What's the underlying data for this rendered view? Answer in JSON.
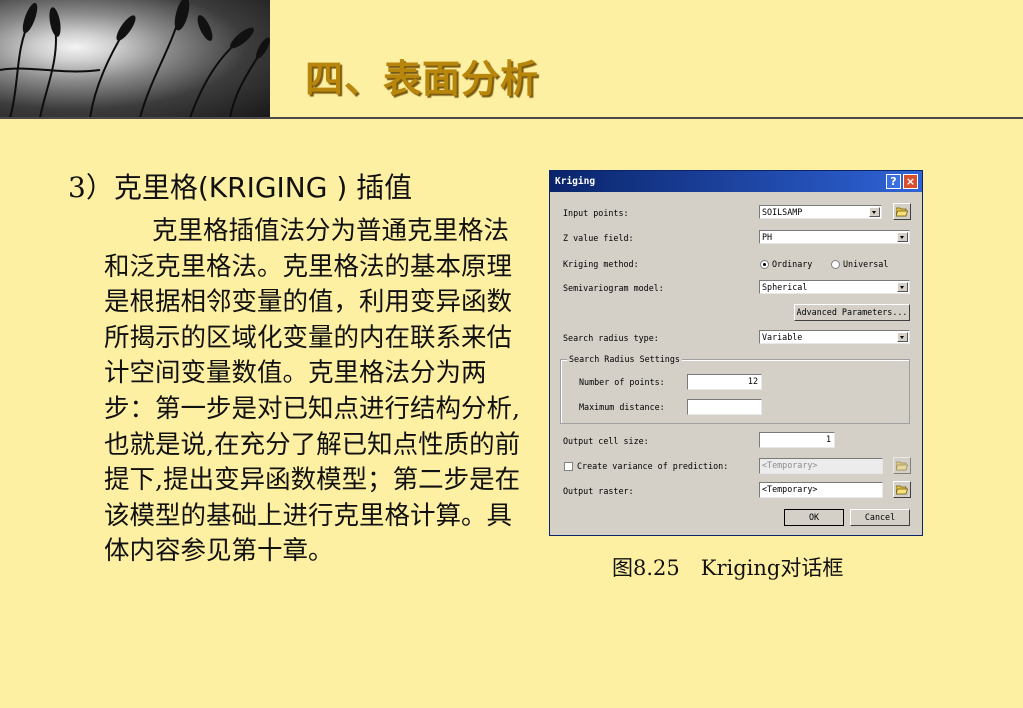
{
  "slide": {
    "title": "四、表面分析",
    "heading_number": "3）",
    "heading_cn": "克里格",
    "heading_latin": "(KRIGING )",
    "heading_suffix": "插值",
    "body": "克里格插值法分为普通克里格法和泛克里格法。克里格法的基本原理是根据相邻变量的值，利用变异函数所揭示的区域化变量的内在联系来估计空间变量数值。克里格法分为两步：第一步是对已知点进行结构分析,也就是说,在充分了解已知点性质的前提下,提出变异函数模型；第二步是在该模型的基础上进行克里格计算。具体内容参见第十章。",
    "caption": "图8.25　Kriging对话框"
  },
  "dialog": {
    "title": "Kriging",
    "help_glyph": "?",
    "close_glyph": "×",
    "input_points_label": "Input points:",
    "input_points_value": "SOILSAMP",
    "z_value_label": "Z value field:",
    "z_value_value": "PH",
    "method_label": "Kriging method:",
    "method_ordinary": "Ordinary",
    "method_universal": "Universal",
    "method_selected": "Ordinary",
    "semivariogram_label": "Semivariogram model:",
    "semivariogram_value": "Spherical",
    "advanced_button": "Advanced Parameters...",
    "search_radius_type_label": "Search radius type:",
    "search_radius_type_value": "Variable",
    "search_group_label": "Search Radius Settings",
    "num_points_label": "Number of points:",
    "num_points_value": "12",
    "max_distance_label": "Maximum distance:",
    "max_distance_value": "",
    "cell_size_label": "Output cell size:",
    "cell_size_value": "1",
    "create_variance_label": "Create variance of prediction:",
    "create_variance_checked": false,
    "variance_placeholder": "<Temporary>",
    "output_raster_label": "Output raster:",
    "output_raster_value": "<Temporary>",
    "ok_button": "OK",
    "cancel_button": "Cancel"
  },
  "colors": {
    "background": "#FEF0A2",
    "title": "#B8860B",
    "dialog_face": "#D4D0C8",
    "titlebar": "#0A246A"
  },
  "icons": {
    "browse": "folder-open-icon",
    "dropdown": "chevron-down-icon",
    "help": "help-icon",
    "close": "close-icon"
  }
}
